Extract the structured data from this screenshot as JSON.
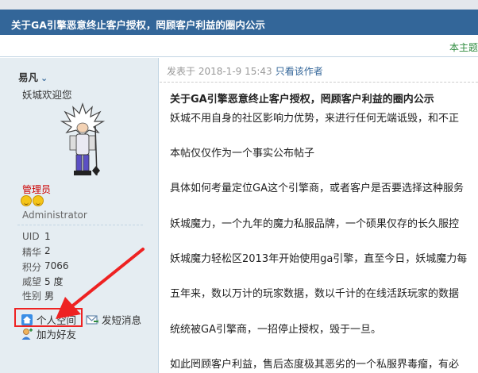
{
  "thread": {
    "title": "关于GA引擎恶意终止客户授权，罔顾客户利益的圈内公示",
    "sub_right_link": "本主题"
  },
  "author": {
    "name": "易凡",
    "signature": "妖城欢迎您",
    "group": "管理员",
    "role": "Administrator",
    "stats": [
      {
        "label": "UID",
        "value": "1"
      },
      {
        "label": "精华",
        "value": "2"
      },
      {
        "label": "积分",
        "value": "7066"
      },
      {
        "label": "威望",
        "value": "5 度"
      },
      {
        "label": "性别",
        "value": "男"
      }
    ],
    "actions": {
      "space": "个人空间",
      "message": "发短消息",
      "friend": "加为好友"
    }
  },
  "post": {
    "meta_prefix": "发表于 2018-1-9 15:43",
    "only_author": "只看该作者",
    "paragraphs": [
      "关于GA引擎恶意终止客户授权，罔顾客户利益的圈内公示",
      "妖城不用自身的社区影响力优势，来进行任何无端诋毁，和不正",
      "本帖仅仅作为一个事实公布帖子",
      "具体如何考量定位GA这个引擎商，或者客户是否要选择这种服务",
      "妖城魔力，一个九年的魔力私服品牌，一个硕果仅存的长久服控",
      "妖城魔力轻松区2013年开始使用ga引擎，直至今日，妖城魔力每",
      "五年来，数以万计的玩家数据，数以千计的在线活跃玩家的数据",
      "统统被GA引擎商，一招停止授权，毁于一旦。",
      "如此罔顾客户利益，售后态度极其恶劣的一个私服界毒瘤，有必"
    ]
  },
  "colors": {
    "title_bar": "#336699",
    "sidebar_bg": "#e5edf2",
    "group_red": "#cc0000",
    "highlight_red": "#ee2222",
    "link_green": "#2e8b3e"
  }
}
